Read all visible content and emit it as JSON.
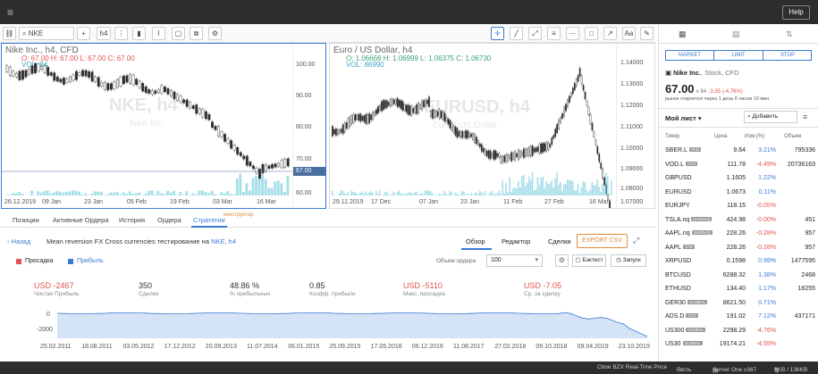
{
  "topbar": {
    "menu_icon": "hamburger-icon",
    "help_label": "Help"
  },
  "toolbar": {
    "search_value": "NKE",
    "timeframe": "h4",
    "right_buttons": [
      "Aa"
    ]
  },
  "chart_left": {
    "title": "Nike Inc., h4, CFD",
    "ohlc": "O: 67.00 H: 67.00 L: 67.00 C: 67.00",
    "vol": "VOL: 84",
    "watermark": "NKE, h4",
    "watermark_sub": "Nike Inc.",
    "price_ticks": [
      "100.00",
      "90.00",
      "80.00",
      "70.00",
      "60.00"
    ],
    "last_price": "67.00",
    "date_ticks": [
      "26.12.2019",
      "09 Jan",
      "23 Jan",
      "05 Feb",
      "19 Feb",
      "03 Mar",
      "16 Mar"
    ]
  },
  "chart_right": {
    "title": "Euro / US Dollar, h4",
    "ohlc": "O: 1.06666  H: 1.06999  L: 1.06375  C: 1.06730",
    "vol": "VOL: 86990",
    "watermark": "EURUSD, h4",
    "watermark_sub": "Euro / US Dollar",
    "price_ticks": [
      "1.14000",
      "1.13000",
      "1.12000",
      "1.11000",
      "1.10000",
      "1.09000",
      "1.08000",
      "1.07000"
    ],
    "date_ticks": [
      "29.11.2019",
      "17 Dec",
      "07 Jan",
      "23 Jan",
      "11 Feb",
      "27 Feb",
      "16 Mar"
    ]
  },
  "bottom_tabs": {
    "items": [
      "Позиции",
      "Активные Ордера",
      "История",
      "Ордера",
      "Стратегии"
    ],
    "badge": "конструктор"
  },
  "strategy": {
    "back_label": "Назад",
    "title": "Mean reversion FX Cross currencies тестирование на",
    "symbol_link": "NKE, h4",
    "tabs": [
      "Обзор",
      "Редактор",
      "Сделки"
    ],
    "export_label": "EXPORT CSV",
    "legend_drawdown": "Просадка",
    "legend_profit": "Прибыль",
    "order_volume_label": "Объем ордера",
    "order_volume_value": "100",
    "backtest_label": "Бэктест",
    "run_label": "Запуск"
  },
  "metrics": [
    {
      "value": "USD -2467",
      "label": "Чистая Прибыль",
      "color": "#e0534f"
    },
    {
      "value": "350",
      "label": "Сделки",
      "color": "#333333"
    },
    {
      "value": "48.86 %",
      "label": "% прибыльных",
      "color": "#333333"
    },
    {
      "value": "0.85",
      "label": "Коэфф. прибыли",
      "color": "#333333"
    },
    {
      "value": "USD -5110",
      "label": "Макс. просадка",
      "color": "#e0534f"
    },
    {
      "value": "USD -7.05",
      "label": "Ср. за сделку",
      "color": "#e0534f"
    }
  ],
  "equity_chart": {
    "y_ticks": [
      "0",
      "-2000"
    ],
    "x_ticks": [
      "25.02.2011",
      "18.08.2011",
      "03.05.2012",
      "17.12.2012",
      "20.09.2013",
      "11.07.2014",
      "06.01.2015",
      "25.09.2015",
      "17.05.2016",
      "06.12.2016",
      "11.08.2017",
      "27.02.2018",
      "09.10.2018",
      "09.04.2019",
      "23.10.2019"
    ]
  },
  "right_panel": {
    "order_buttons": [
      "MARKET",
      "LIMIT",
      "STOP"
    ],
    "instrument_name": "Nike Inc.",
    "instrument_type": ", Stock, CFD",
    "price": "67.00",
    "price_change": "-3.35 (-4.76%)",
    "price_sub": "x 84",
    "market_status": "рынок откроется через 1 день 6 часов 10 мин",
    "watchlist_title": "Мой лист",
    "add_label": "Добавить",
    "columns": [
      "Тикер",
      "Цена",
      "Изм.(%)",
      "Объем"
    ],
    "rows": [
      {
        "ticker": "SBER.L",
        "badge": "CFD",
        "price": "9.64",
        "change": "3.21%",
        "volume": "795336",
        "dir": "up"
      },
      {
        "ticker": "VOD.L",
        "badge": "CFD",
        "price": "111.78",
        "change": "-4.49%",
        "volume": "20736163",
        "dir": "down"
      },
      {
        "ticker": "GBPUSD",
        "badge": "",
        "price": "1.1605",
        "change": "1.22%",
        "volume": "",
        "dir": "up"
      },
      {
        "ticker": "EURUSD",
        "badge": "",
        "price": "1.0673",
        "change": "0.11%",
        "volume": "",
        "dir": "up"
      },
      {
        "ticker": "EURJPY",
        "badge": "",
        "price": "118.15",
        "change": "-0.05%",
        "volume": "",
        "dir": "down"
      },
      {
        "ticker": "TSLA.nq",
        "badge": "NASDAQ",
        "price": "424.98",
        "change": "-0.00%",
        "volume": "451",
        "dir": "down"
      },
      {
        "ticker": "AAPL.nq",
        "badge": "NASDAQ",
        "price": "228.26",
        "change": "-0.28%",
        "volume": "957",
        "dir": "down"
      },
      {
        "ticker": "AAPL",
        "badge": "CFD",
        "price": "228.26",
        "change": "-0.28%",
        "volume": "957",
        "dir": "down"
      },
      {
        "ticker": "XRPUSD",
        "badge": "",
        "price": "0.1598",
        "change": "0.99%",
        "volume": "1477595",
        "dir": "up"
      },
      {
        "ticker": "BTCUSD",
        "badge": "",
        "price": "6288.32",
        "change": "1.38%",
        "volume": "2468",
        "dir": "up"
      },
      {
        "ticker": "ETHUSD",
        "badge": "",
        "price": "134.40",
        "change": "1.17%",
        "volume": "18255",
        "dir": "up"
      },
      {
        "ticker": "GER30",
        "badge": "GLOBAL",
        "price": "8621.50",
        "change": "0.71%",
        "volume": "",
        "dir": "up"
      },
      {
        "ticker": "ADS.D",
        "badge": "CFD",
        "price": "191.02",
        "change": "7.12%",
        "volume": "437171",
        "dir": "up"
      },
      {
        "ticker": "US300",
        "badge": "GLOBAL",
        "price": "2298.29",
        "change": "-4.76%",
        "volume": "",
        "dir": "down"
      },
      {
        "ticker": "US30",
        "badge": "GLOBAL",
        "price": "19174.21",
        "change": "-4.55%",
        "volume": "",
        "dir": "down"
      }
    ]
  },
  "status": {
    "feed": "Cboe BZX Real-Time Price",
    "user": "Гость",
    "server": "Server One v367",
    "traffic": "9KB / 136KB"
  },
  "colors": {
    "accent": "#3a7bd5",
    "up": "#3a7bd5",
    "down": "#e0534f",
    "dark": "#2d2d2d"
  }
}
